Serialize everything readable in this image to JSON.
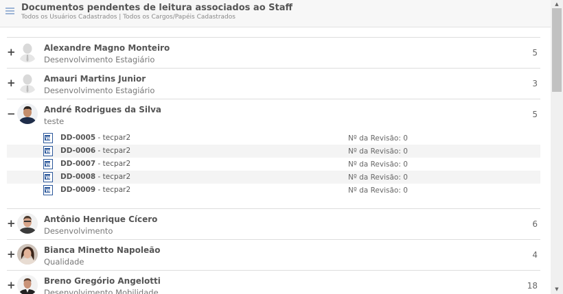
{
  "header": {
    "title": "Documentos pendentes de leitura associados ao Staff",
    "subtitle": "Todos os Usuários Cadastrados | Todos os Cargos/Papéis Cadastrados"
  },
  "people": [
    {
      "toggle": "+",
      "name": "Alexandre Magno Monteiro",
      "role": "Desenvolvimento Estagiário",
      "count": "5",
      "avatar": "default-avatar-icon"
    },
    {
      "toggle": "+",
      "name": "Amauri Martins Junior",
      "role": "Desenvolvimento Estagiário",
      "count": "3",
      "avatar": "default-avatar-icon"
    },
    {
      "toggle": "−",
      "name": "André Rodrigues da Silva",
      "role": "teste",
      "count": "5",
      "avatar": "photo-avatar",
      "documents": [
        {
          "code": "DD-0005",
          "name": " - tecpar2",
          "revision": "Nº da Revisão: 0"
        },
        {
          "code": "DD-0006",
          "name": " - tecpar2",
          "revision": "Nº da Revisão: 0"
        },
        {
          "code": "DD-0007",
          "name": " - tecpar2",
          "revision": "Nº da Revisão: 0"
        },
        {
          "code": "DD-0008",
          "name": " - tecpar2",
          "revision": "Nº da Revisão: 0"
        },
        {
          "code": "DD-0009",
          "name": " - tecpar2",
          "revision": "Nº da Revisão: 0"
        }
      ]
    },
    {
      "toggle": "+",
      "name": "Antônio Henrique Cícero",
      "role": "Desenvolvimento",
      "count": "6",
      "avatar": "photo-avatar"
    },
    {
      "toggle": "+",
      "name": "Bianca Minetto Napoleão",
      "role": "Qualidade",
      "count": "4",
      "avatar": "photo-avatar"
    },
    {
      "toggle": "+",
      "name": "Breno Gregório Angelotti",
      "role": "Desenvolvimento Mobilidade",
      "count": "18",
      "avatar": "photo-avatar"
    }
  ],
  "icons": {
    "menu": "hamburger-menu-icon",
    "document": "word-document-icon",
    "scroll_up": "▲",
    "scroll_down": "▼"
  },
  "colors": {
    "header_bg": "#f7f7f7",
    "menu_icon": "#9cb4d6",
    "doc_icon": "#2b579a"
  }
}
